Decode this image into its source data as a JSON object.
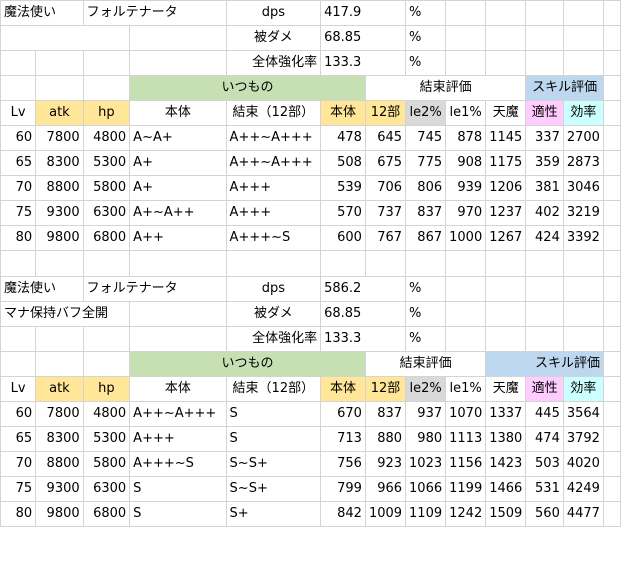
{
  "section1": {
    "class": "魔法使い",
    "weapon": "フォルテナータ",
    "note": "",
    "dps_label": "dps",
    "dps_value": "417.9",
    "damage_label": "被ダメ",
    "damage_value": "68.85",
    "buff_label": "全体強化率",
    "buff_value": "133.3",
    "pct": "%"
  },
  "section2": {
    "class": "魔法使い",
    "weapon": "フォルテナータ",
    "note": "マナ保持バフ全開",
    "dps_label": "dps",
    "dps_value": "586.2",
    "damage_label": "被ダメ",
    "damage_value": "68.85",
    "buff_label": "全体強化率",
    "buff_value": "133.3",
    "pct": "%"
  },
  "group_headers": {
    "usual": "いつもの",
    "bond_eval": "結束評価",
    "skill_eval": "スキル評価"
  },
  "columns": [
    "Lv",
    "atk",
    "hp",
    "本体",
    "結束（12部）",
    "本体",
    "12部",
    "le2%",
    "le1%",
    "天魔",
    "適性",
    "効率"
  ],
  "table1": [
    [
      "60",
      "7800",
      "4800",
      "A~A+",
      "A++~A+++",
      "478",
      "645",
      "745",
      "878",
      "1145",
      "337",
      "2700"
    ],
    [
      "65",
      "8300",
      "5300",
      "A+",
      "A++~A+++",
      "508",
      "675",
      "775",
      "908",
      "1175",
      "359",
      "2873"
    ],
    [
      "70",
      "8800",
      "5800",
      "A+",
      "A+++",
      "539",
      "706",
      "806",
      "939",
      "1206",
      "381",
      "3046"
    ],
    [
      "75",
      "9300",
      "6300",
      "A+~A++",
      "A+++",
      "570",
      "737",
      "837",
      "970",
      "1237",
      "402",
      "3219"
    ],
    [
      "80",
      "9800",
      "6800",
      "A++",
      "A+++~S",
      "600",
      "767",
      "867",
      "1000",
      "1267",
      "424",
      "3392"
    ]
  ],
  "table2": [
    [
      "60",
      "7800",
      "4800",
      "A++~A+++",
      "S",
      "670",
      "837",
      "937",
      "1070",
      "1337",
      "445",
      "3564"
    ],
    [
      "65",
      "8300",
      "5300",
      "A+++",
      "S",
      "713",
      "880",
      "980",
      "1113",
      "1380",
      "474",
      "3792"
    ],
    [
      "70",
      "8800",
      "5800",
      "A+++~S",
      "S~S+",
      "756",
      "923",
      "1023",
      "1156",
      "1423",
      "503",
      "4020"
    ],
    [
      "75",
      "9300",
      "6300",
      "S",
      "S~S+",
      "799",
      "966",
      "1066",
      "1199",
      "1466",
      "531",
      "4249"
    ],
    [
      "80",
      "9800",
      "6800",
      "S",
      "S+",
      "842",
      "1009",
      "1109",
      "1242",
      "1509",
      "560",
      "4477"
    ]
  ],
  "colors": {
    "yellow": "#ffe699",
    "green": "#c6e0b4",
    "grey": "#d9d9d9",
    "blue": "#bdd7ee",
    "pink": "#ffccff",
    "cyan": "#ccffff"
  }
}
